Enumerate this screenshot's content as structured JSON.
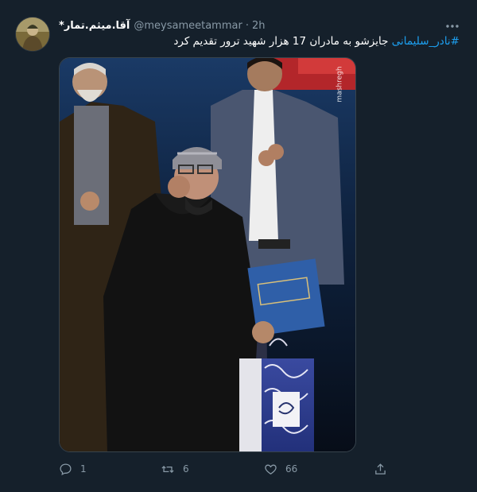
{
  "tweet": {
    "display_name": "*آقا.میثم.تمار",
    "handle": "@meysameetammar",
    "separator": "·",
    "time": "2h",
    "hashtag": "#نادر_سلیمانی",
    "body_text": " جایزشو به مادران 17 هزار شهید ترور تقدیم کرد",
    "media_watermark": "mashregh",
    "icons": {
      "more": "more-dots-icon",
      "reply": "reply-icon",
      "retweet": "retweet-icon",
      "like": "heart-icon",
      "share": "share-icon"
    },
    "stats": {
      "replies": "1",
      "retweets": "6",
      "likes": "66"
    }
  },
  "colors": {
    "background": "#15202b",
    "accent": "#1da1f2",
    "muted": "#8899a6",
    "border": "#38444d"
  }
}
